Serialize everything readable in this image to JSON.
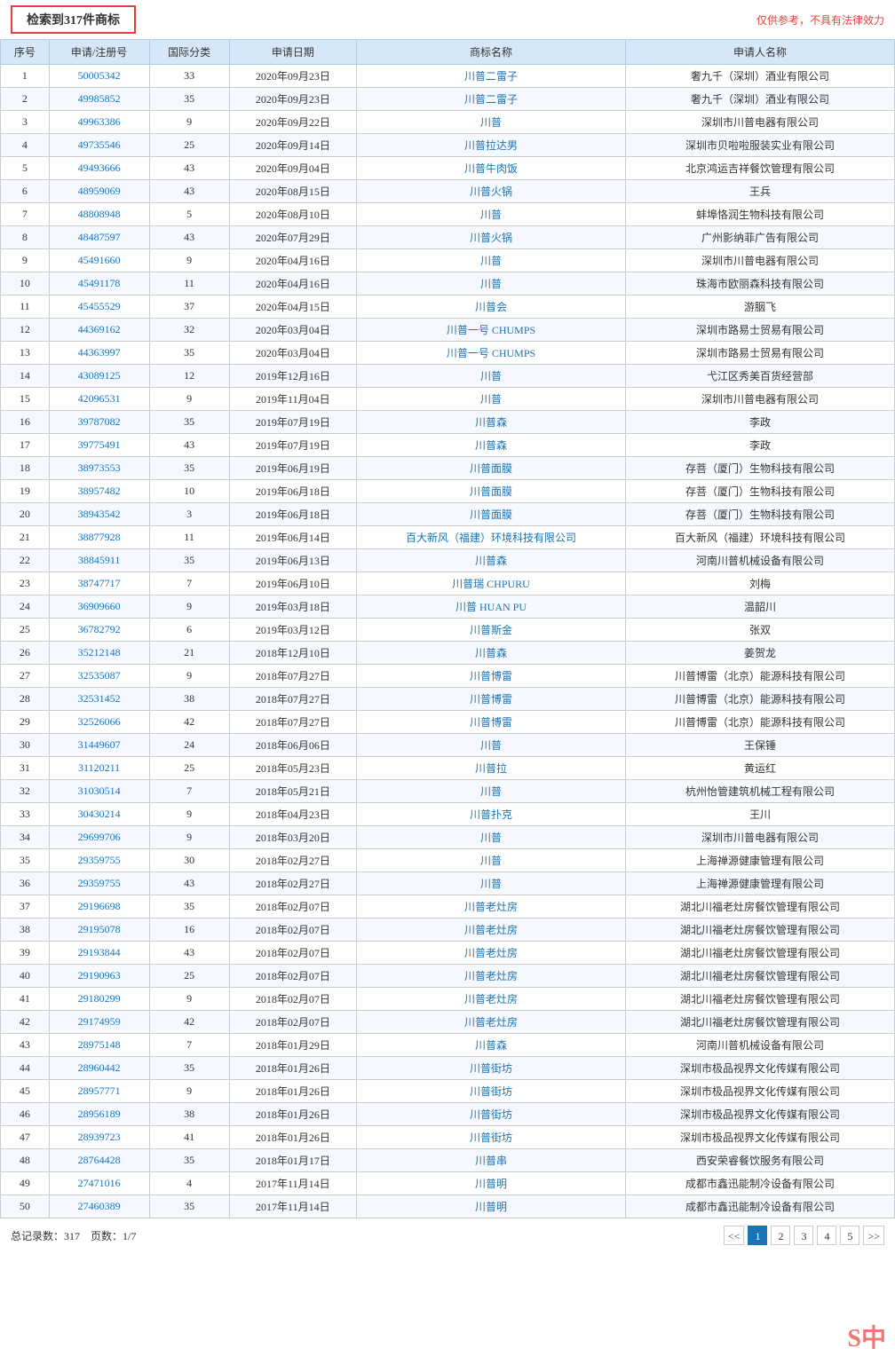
{
  "topBar": {
    "searchResult": "检索到317件商标",
    "disclaimer": "仅供参考，不具有法律效力"
  },
  "table": {
    "headers": [
      "序号",
      "申请/注册号",
      "国际分类",
      "申请日期",
      "商标名称",
      "申请人名称"
    ],
    "rows": [
      [
        "1",
        "50005342",
        "33",
        "2020年09月23日",
        "川普二雷子",
        "奢九千（深圳）酒业有限公司"
      ],
      [
        "2",
        "49985852",
        "35",
        "2020年09月23日",
        "川普二雷子",
        "奢九千（深圳）酒业有限公司"
      ],
      [
        "3",
        "49963386",
        "9",
        "2020年09月22日",
        "川普",
        "深圳市川普电器有限公司"
      ],
      [
        "4",
        "49735546",
        "25",
        "2020年09月14日",
        "川普拉达男",
        "深圳市贝啦啦服装实业有限公司"
      ],
      [
        "5",
        "49493666",
        "43",
        "2020年09月04日",
        "川普牛肉饭",
        "北京鸿运吉祥餐饮管理有限公司"
      ],
      [
        "6",
        "48959069",
        "43",
        "2020年08月15日",
        "川普火锅",
        "王兵"
      ],
      [
        "7",
        "48808948",
        "5",
        "2020年08月10日",
        "川普",
        "蚌埠恪润生物科技有限公司"
      ],
      [
        "8",
        "48487597",
        "43",
        "2020年07月29日",
        "川普火锅",
        "广州影纳菲广告有限公司"
      ],
      [
        "9",
        "45491660",
        "9",
        "2020年04月16日",
        "川普",
        "深圳市川普电器有限公司"
      ],
      [
        "10",
        "45491178",
        "11",
        "2020年04月16日",
        "川普",
        "珠海市欧丽森科技有限公司"
      ],
      [
        "11",
        "45455529",
        "37",
        "2020年04月15日",
        "川普会",
        "游胭飞"
      ],
      [
        "12",
        "44369162",
        "32",
        "2020年03月04日",
        "川普一号 CHUMPS",
        "深圳市路易士贸易有限公司"
      ],
      [
        "13",
        "44363997",
        "35",
        "2020年03月04日",
        "川普一号 CHUMPS",
        "深圳市路易士贸易有限公司"
      ],
      [
        "14",
        "43089125",
        "12",
        "2019年12月16日",
        "川普",
        "弋江区秀美百货经营部"
      ],
      [
        "15",
        "42096531",
        "9",
        "2019年11月04日",
        "川普",
        "深圳市川普电器有限公司"
      ],
      [
        "16",
        "39787082",
        "35",
        "2019年07月19日",
        "川普森",
        "李政"
      ],
      [
        "17",
        "39775491",
        "43",
        "2019年07月19日",
        "川普森",
        "李政"
      ],
      [
        "18",
        "38973553",
        "35",
        "2019年06月19日",
        "川普面膜",
        "存菩（厦门）生物科技有限公司"
      ],
      [
        "19",
        "38957482",
        "10",
        "2019年06月18日",
        "川普面膜",
        "存菩（厦门）生物科技有限公司"
      ],
      [
        "20",
        "38943542",
        "3",
        "2019年06月18日",
        "川普面膜",
        "存菩（厦门）生物科技有限公司"
      ],
      [
        "21",
        "38877928",
        "11",
        "2019年06月14日",
        "百大新风（福建）环境科技有限公司",
        "百大新风（福建）环境科技有限公司"
      ],
      [
        "22",
        "38845911",
        "35",
        "2019年06月13日",
        "川普森",
        "河南川普机械设备有限公司"
      ],
      [
        "23",
        "38747717",
        "7",
        "2019年06月10日",
        "川普瑞 CHPURU",
        "刘梅"
      ],
      [
        "24",
        "36909660",
        "9",
        "2019年03月18日",
        "川普 HUAN PU",
        "温韶川"
      ],
      [
        "25",
        "36782792",
        "6",
        "2019年03月12日",
        "川普斯金",
        "张双"
      ],
      [
        "26",
        "35212148",
        "21",
        "2018年12月10日",
        "川普森",
        "姜贺龙"
      ],
      [
        "27",
        "32535087",
        "9",
        "2018年07月27日",
        "川普博雷",
        "川普博雷（北京）能源科技有限公司"
      ],
      [
        "28",
        "32531452",
        "38",
        "2018年07月27日",
        "川普博雷",
        "川普博雷（北京）能源科技有限公司"
      ],
      [
        "29",
        "32526066",
        "42",
        "2018年07月27日",
        "川普博雷",
        "川普博雷（北京）能源科技有限公司"
      ],
      [
        "30",
        "31449607",
        "24",
        "2018年06月06日",
        "川普",
        "王保锤"
      ],
      [
        "31",
        "31120211",
        "25",
        "2018年05月23日",
        "川普拉",
        "黄运红"
      ],
      [
        "32",
        "31030514",
        "7",
        "2018年05月21日",
        "川普",
        "杭州怡管建筑机械工程有限公司"
      ],
      [
        "33",
        "30430214",
        "9",
        "2018年04月23日",
        "川普扑克",
        "王川"
      ],
      [
        "34",
        "29699706",
        "9",
        "2018年03月20日",
        "川普",
        "深圳市川普电器有限公司"
      ],
      [
        "35",
        "29359755",
        "30",
        "2018年02月27日",
        "川普",
        "上海禅源健康管理有限公司"
      ],
      [
        "36",
        "29359755",
        "43",
        "2018年02月27日",
        "川普",
        "上海禅源健康管理有限公司"
      ],
      [
        "37",
        "29196698",
        "35",
        "2018年02月07日",
        "川普老灶房",
        "湖北川福老灶房餐饮管理有限公司"
      ],
      [
        "38",
        "29195078",
        "16",
        "2018年02月07日",
        "川普老灶房",
        "湖北川福老灶房餐饮管理有限公司"
      ],
      [
        "39",
        "29193844",
        "43",
        "2018年02月07日",
        "川普老灶房",
        "湖北川福老灶房餐饮管理有限公司"
      ],
      [
        "40",
        "29190963",
        "25",
        "2018年02月07日",
        "川普老灶房",
        "湖北川福老灶房餐饮管理有限公司"
      ],
      [
        "41",
        "29180299",
        "9",
        "2018年02月07日",
        "川普老灶房",
        "湖北川福老灶房餐饮管理有限公司"
      ],
      [
        "42",
        "29174959",
        "42",
        "2018年02月07日",
        "川普老灶房",
        "湖北川福老灶房餐饮管理有限公司"
      ],
      [
        "43",
        "28975148",
        "7",
        "2018年01月29日",
        "川普森",
        "河南川普机械设备有限公司"
      ],
      [
        "44",
        "28960442",
        "35",
        "2018年01月26日",
        "川普街坊",
        "深圳市极品视界文化传媒有限公司"
      ],
      [
        "45",
        "28957771",
        "9",
        "2018年01月26日",
        "川普街坊",
        "深圳市极品视界文化传媒有限公司"
      ],
      [
        "46",
        "28956189",
        "38",
        "2018年01月26日",
        "川普街坊",
        "深圳市极品视界文化传媒有限公司"
      ],
      [
        "47",
        "28939723",
        "41",
        "2018年01月26日",
        "川普街坊",
        "深圳市极品视界文化传媒有限公司"
      ],
      [
        "48",
        "28764428",
        "35",
        "2018年01月17日",
        "川普串",
        "西安荣睿餐饮服务有限公司"
      ],
      [
        "49",
        "27471016",
        "4",
        "2017年11月14日",
        "川普明",
        "成都市鑫迅能制冷设备有限公司"
      ],
      [
        "50",
        "27460389",
        "35",
        "2017年11月14日",
        "川普明",
        "成都市鑫迅能制冷设备有限公司"
      ]
    ]
  },
  "footer": {
    "totalLabel": "总记录数：",
    "total": "317",
    "pageLabel": "页数：",
    "currentPage": "1",
    "totalPages": "7",
    "pages": [
      "1",
      "2",
      "3",
      "4",
      "5"
    ],
    "prevBtn": "<<",
    "nextBtn": ">>"
  },
  "watermark": "S中"
}
